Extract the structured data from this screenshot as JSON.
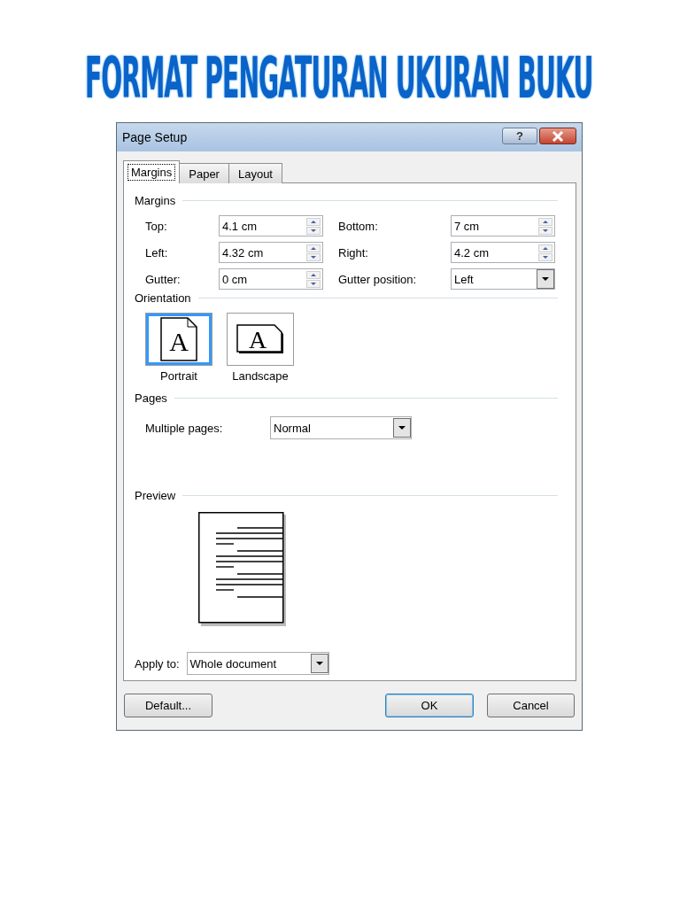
{
  "heading": "FORMAT PENGATURAN UKURAN BUKU",
  "window": {
    "title": "Page Setup",
    "help_button": "?"
  },
  "tabs": [
    {
      "label": "Margins",
      "selected": true
    },
    {
      "label": "Paper",
      "selected": false
    },
    {
      "label": "Layout",
      "selected": false
    }
  ],
  "margins": {
    "label": "Margins",
    "fields": [
      {
        "label": "Top:",
        "value": "4.1 cm",
        "kind": "spin"
      },
      {
        "label": "Bottom:",
        "value": "7 cm",
        "kind": "spin"
      },
      {
        "label": "Left:",
        "value": "4.32 cm",
        "kind": "spin"
      },
      {
        "label": "Right:",
        "value": "4.2 cm",
        "kind": "spin"
      },
      {
        "label": "Gutter:",
        "value": "0 cm",
        "kind": "spin"
      },
      {
        "label": "Gutter position:",
        "value": "Left",
        "kind": "dropdown"
      }
    ]
  },
  "orientation": {
    "label": "Orientation",
    "options": [
      {
        "label": "Portrait",
        "icon_letter": "A",
        "kind": "portrait",
        "selected": true
      },
      {
        "label": "Landscape",
        "icon_letter": "A",
        "kind": "landscape",
        "selected": false
      }
    ]
  },
  "pages": {
    "label": "Pages",
    "multiple_pages": {
      "label": "Multiple pages:",
      "value": "Normal"
    }
  },
  "preview": {
    "label": "Preview"
  },
  "apply_to": {
    "label": "Apply to:",
    "value": "Whole document"
  },
  "buttons": [
    {
      "label": "Default...",
      "focused": false
    },
    {
      "label": "OK",
      "focused": true
    },
    {
      "label": "Cancel",
      "focused": false
    }
  ]
}
